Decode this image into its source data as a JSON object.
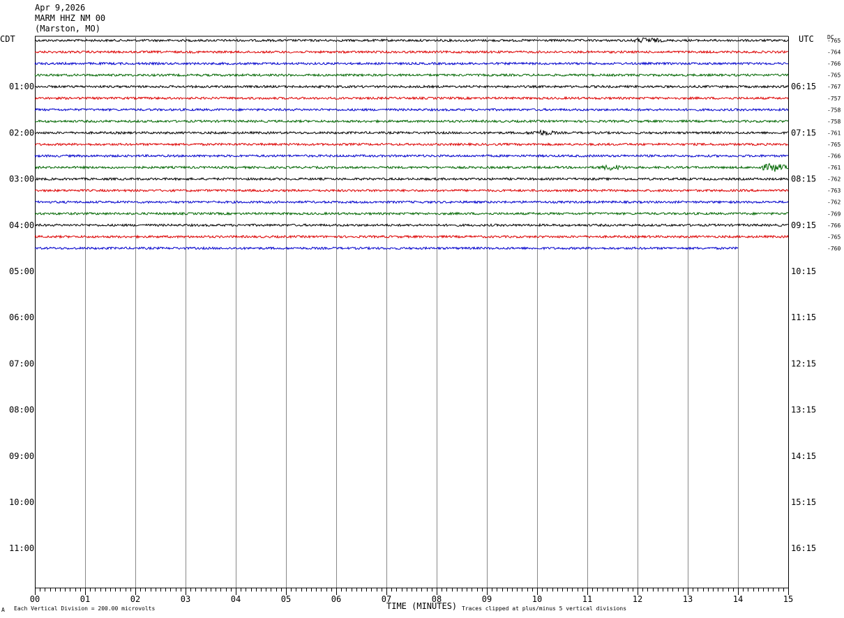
{
  "header": {
    "date": "Apr 9,2026",
    "station": "MARM HHZ NM 00",
    "location": "(Marston, MO)"
  },
  "left_axis_title": "CDT",
  "right_axis_title": "UTC",
  "dc_label": "DC",
  "footer": {
    "corner_mark": "A",
    "scale_note": "Each Vertical Division =  200.00 microvolts",
    "xlabel": "TIME (MINUTES)",
    "clip_note": "Traces clipped at plus/minus 5 vertical divisions"
  },
  "chart_data": {
    "type": "line",
    "title": "MARM HHZ NM 00",
    "xlabel": "TIME (MINUTES)",
    "xlim": [
      0,
      15
    ],
    "x_ticks": [
      "00",
      "01",
      "02",
      "03",
      "04",
      "05",
      "06",
      "07",
      "08",
      "09",
      "10",
      "11",
      "12",
      "13",
      "14",
      "15"
    ],
    "left_hour_labels": [
      "01:00",
      "02:00",
      "03:00",
      "04:00",
      "05:00",
      "06:00",
      "07:00",
      "08:00",
      "09:00",
      "10:00",
      "11:00"
    ],
    "right_hour_labels": [
      "06:15",
      "07:15",
      "08:15",
      "09:15",
      "10:15",
      "11:15",
      "12:15",
      "13:15",
      "14:15",
      "15:15",
      "16:15"
    ],
    "trace_colors": [
      "#000000",
      "#dd0000",
      "#0000cc",
      "#006600"
    ],
    "trace_dc_offsets": [
      "-765",
      "-764",
      "-766",
      "-765",
      "-767",
      "-757",
      "-758",
      "-758",
      "-761",
      "-765",
      "-766",
      "-761",
      "-762",
      "-763",
      "-762",
      "-769",
      "-766",
      "-765",
      "-760"
    ],
    "trace_end_minutes": [
      15,
      15,
      15,
      15,
      15,
      15,
      15,
      15,
      15,
      15,
      15,
      15,
      15,
      15,
      15,
      15,
      15,
      15,
      14
    ],
    "total_rows": 48,
    "event_bursts": [
      {
        "trace": 0,
        "minute": 12.2,
        "strength": 1.6
      },
      {
        "trace": 11,
        "minute": 11.5,
        "strength": 1.5
      },
      {
        "trace": 11,
        "minute": 14.7,
        "strength": 2.6
      },
      {
        "trace": 8,
        "minute": 10.1,
        "strength": 1.4
      }
    ]
  }
}
